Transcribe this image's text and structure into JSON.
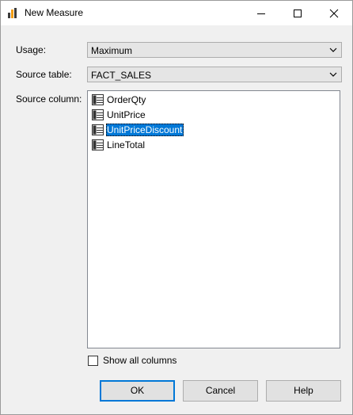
{
  "window": {
    "title": "New Measure"
  },
  "form": {
    "usage_label": "Usage:",
    "usage_value": "Maximum",
    "source_table_label": "Source table:",
    "source_table_value": "FACT_SALES",
    "source_column_label": "Source column:"
  },
  "columns": [
    {
      "name": "OrderQty",
      "selected": false
    },
    {
      "name": "UnitPrice",
      "selected": false
    },
    {
      "name": "UnitPriceDiscount",
      "selected": true
    },
    {
      "name": "LineTotal",
      "selected": false
    }
  ],
  "show_all_columns": {
    "label": "Show all columns",
    "checked": false
  },
  "buttons": {
    "ok": "OK",
    "cancel": "Cancel",
    "help": "Help"
  },
  "colors": {
    "selection": "#0078d7",
    "default_button_border": "#0078d7"
  },
  "icons": {
    "app": "bar-chart-icon",
    "column": "column-icon"
  }
}
